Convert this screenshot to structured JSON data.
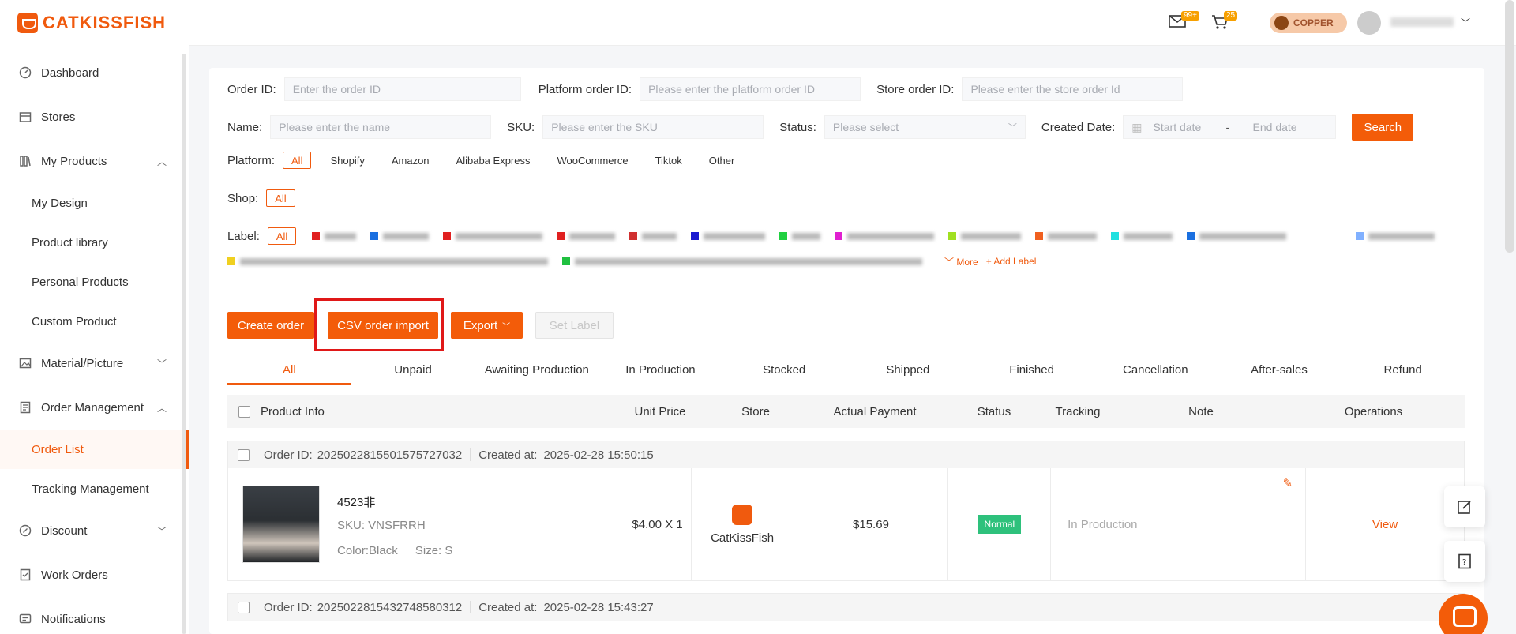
{
  "brand": {
    "name": "CATKISSFISH",
    "color": "#f05a0e"
  },
  "sidebar": {
    "items": [
      {
        "label": "Dashboard",
        "icon": "dashboard-icon"
      },
      {
        "label": "Stores",
        "icon": "store-icon"
      },
      {
        "label": "My Products",
        "icon": "products-icon",
        "expanded": true
      },
      {
        "label": "My Design"
      },
      {
        "label": "Product library"
      },
      {
        "label": "Personal Products"
      },
      {
        "label": "Custom Product"
      },
      {
        "label": "Material/Picture",
        "icon": "picture-icon"
      },
      {
        "label": "Order Management",
        "icon": "orders-icon",
        "expanded": true
      },
      {
        "label": "Order List",
        "active": true
      },
      {
        "label": "Tracking Management"
      },
      {
        "label": "Discount",
        "icon": "discount-icon"
      },
      {
        "label": "Work Orders",
        "icon": "work-orders-icon"
      },
      {
        "label": "Notifications",
        "icon": "notifications-icon"
      }
    ]
  },
  "topbar": {
    "mail_badge": "99+",
    "cart_badge": "25",
    "tier": "COPPER"
  },
  "filters": {
    "order_id": {
      "label": "Order ID:",
      "placeholder": "Enter the order ID"
    },
    "platform_order_id": {
      "label": "Platform order ID:",
      "placeholder": "Please enter the platform order ID"
    },
    "store_order_id": {
      "label": "Store order ID:",
      "placeholder": "Please enter the store order Id"
    },
    "name": {
      "label": "Name:",
      "placeholder": "Please enter the name"
    },
    "sku": {
      "label": "SKU:",
      "placeholder": "Please enter the SKU"
    },
    "status": {
      "label": "Status:",
      "placeholder": "Please select"
    },
    "created": {
      "label": "Created Date:",
      "start": "Start date",
      "sep": "-",
      "end": "End date"
    },
    "search": "Search",
    "platform_label": "Platform:",
    "platforms": [
      "All",
      "Shopify",
      "Amazon",
      "Alibaba Express",
      "WooCommerce",
      "Tiktok",
      "Other"
    ],
    "shop_label": "Shop:",
    "shop_all": "All",
    "label_label": "Label:",
    "label_all": "All",
    "more": "More",
    "add_label": "Add Label"
  },
  "actions": {
    "create": "Create order",
    "csv": "CSV order import",
    "export": "Export",
    "set_label": "Set Label"
  },
  "tabs": [
    "All",
    "Unpaid",
    "Awaiting Production",
    "In Production",
    "Stocked",
    "Shipped",
    "Finished",
    "Cancellation",
    "After-sales",
    "Refund"
  ],
  "columns": [
    "Product Info",
    "Unit Price",
    "Store",
    "Actual Payment",
    "Status",
    "Tracking",
    "Note",
    "Operations"
  ],
  "orders": [
    {
      "order_id_label": "Order ID:",
      "order_id": "2025022815501575727032",
      "created_label": "Created at:",
      "created": "2025-02-28 15:50:15",
      "product_name": "4523非",
      "sku": "SKU:  VNSFRRH",
      "color": "Color:Black",
      "size": "Size:  S",
      "unit_price": "$4.00 X 1",
      "store": "CatKissFish",
      "payment": "$15.69",
      "status": "Normal",
      "tracking": "In Production",
      "operation": "View"
    },
    {
      "order_id_label": "Order ID:",
      "order_id": "2025022815432748580312",
      "created_label": "Created at:",
      "created": "2025-02-28 15:43:27"
    }
  ]
}
